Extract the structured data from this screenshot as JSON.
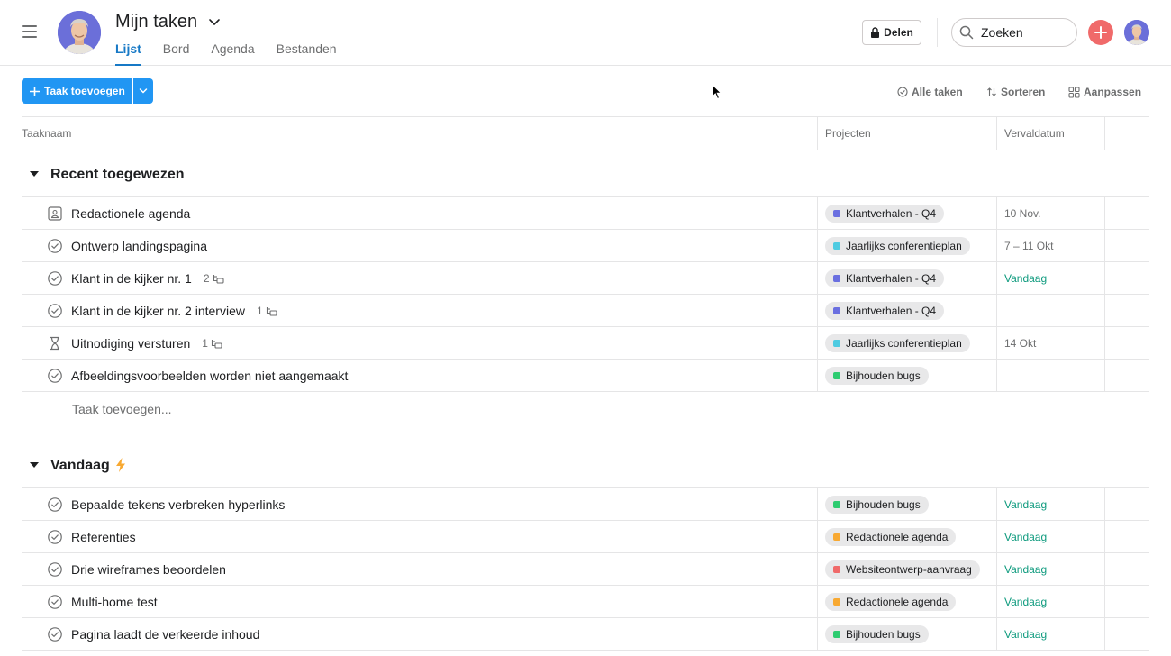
{
  "header": {
    "title": "Mijn taken",
    "tabs": [
      {
        "label": "Lijst",
        "active": true
      },
      {
        "label": "Bord",
        "active": false
      },
      {
        "label": "Agenda",
        "active": false
      },
      {
        "label": "Bestanden",
        "active": false
      }
    ],
    "share_label": "Delen",
    "search_placeholder": "Zoeken"
  },
  "toolbar": {
    "add_task_label": "Taak toevoegen",
    "all_tasks_label": "Alle taken",
    "sort_label": "Sorteren",
    "customize_label": "Aanpassen"
  },
  "table": {
    "columns": [
      "Taaknaam",
      "Projecten",
      "Vervaldatum"
    ],
    "add_task_row_label": "Taak toevoegen...",
    "sections": [
      {
        "title": "Recent toegewezen",
        "rows": [
          {
            "icon": "approval-icon",
            "name": "Redactionele agenda",
            "subtasks": "",
            "project": "Klantverhalen - Q4",
            "project_color": "#6a6fe0",
            "due": "10 Nov.",
            "due_today": false
          },
          {
            "icon": "check-circle-icon",
            "name": "Ontwerp landingspagina",
            "subtasks": "",
            "project": "Jaarlijks conferentieplan",
            "project_color": "#4ecbe1",
            "due": "7 – 11 Okt",
            "due_today": false
          },
          {
            "icon": "check-circle-icon",
            "name": "Klant in de kijker nr. 1",
            "subtasks": "2",
            "project": "Klantverhalen - Q4",
            "project_color": "#6a6fe0",
            "due": "Vandaag",
            "due_today": true
          },
          {
            "icon": "check-circle-icon",
            "name": "Klant in de kijker nr. 2 interview",
            "subtasks": "1",
            "project": "Klantverhalen - Q4",
            "project_color": "#6a6fe0",
            "due": "",
            "due_today": false
          },
          {
            "icon": "hourglass-icon",
            "name": "Uitnodiging versturen",
            "subtasks": "1",
            "project": "Jaarlijks conferentieplan",
            "project_color": "#4ecbe1",
            "due": "14 Okt",
            "due_today": false
          },
          {
            "icon": "check-circle-icon",
            "name": "Afbeeldingsvoorbeelden worden niet aangemaakt",
            "subtasks": "",
            "project": "Bijhouden bugs",
            "project_color": "#2ecc71",
            "due": "",
            "due_today": false
          }
        ]
      },
      {
        "title": "Vandaag",
        "rows": [
          {
            "icon": "check-circle-icon",
            "name": "Bepaalde tekens verbreken hyperlinks",
            "subtasks": "",
            "project": "Bijhouden bugs",
            "project_color": "#2ecc71",
            "due": "Vandaag",
            "due_today": true
          },
          {
            "icon": "check-circle-icon",
            "name": "Referenties",
            "subtasks": "",
            "project": "Redactionele agenda",
            "project_color": "#f8a932",
            "due": "Vandaag",
            "due_today": true
          },
          {
            "icon": "check-circle-icon",
            "name": "Drie wireframes beoordelen",
            "subtasks": "",
            "project": "Websiteontwerp-aanvraag",
            "project_color": "#f06a6a",
            "due": "Vandaag",
            "due_today": true
          },
          {
            "icon": "check-circle-icon",
            "name": "Multi-home test",
            "subtasks": "",
            "project": "Redactionele agenda",
            "project_color": "#f8a932",
            "due": "Vandaag",
            "due_today": true
          },
          {
            "icon": "check-circle-icon",
            "name": "Pagina laadt de verkeerde inhoud",
            "subtasks": "",
            "project": "Bijhouden bugs",
            "project_color": "#2ecc71",
            "due": "Vandaag",
            "due_today": true
          }
        ]
      }
    ]
  }
}
